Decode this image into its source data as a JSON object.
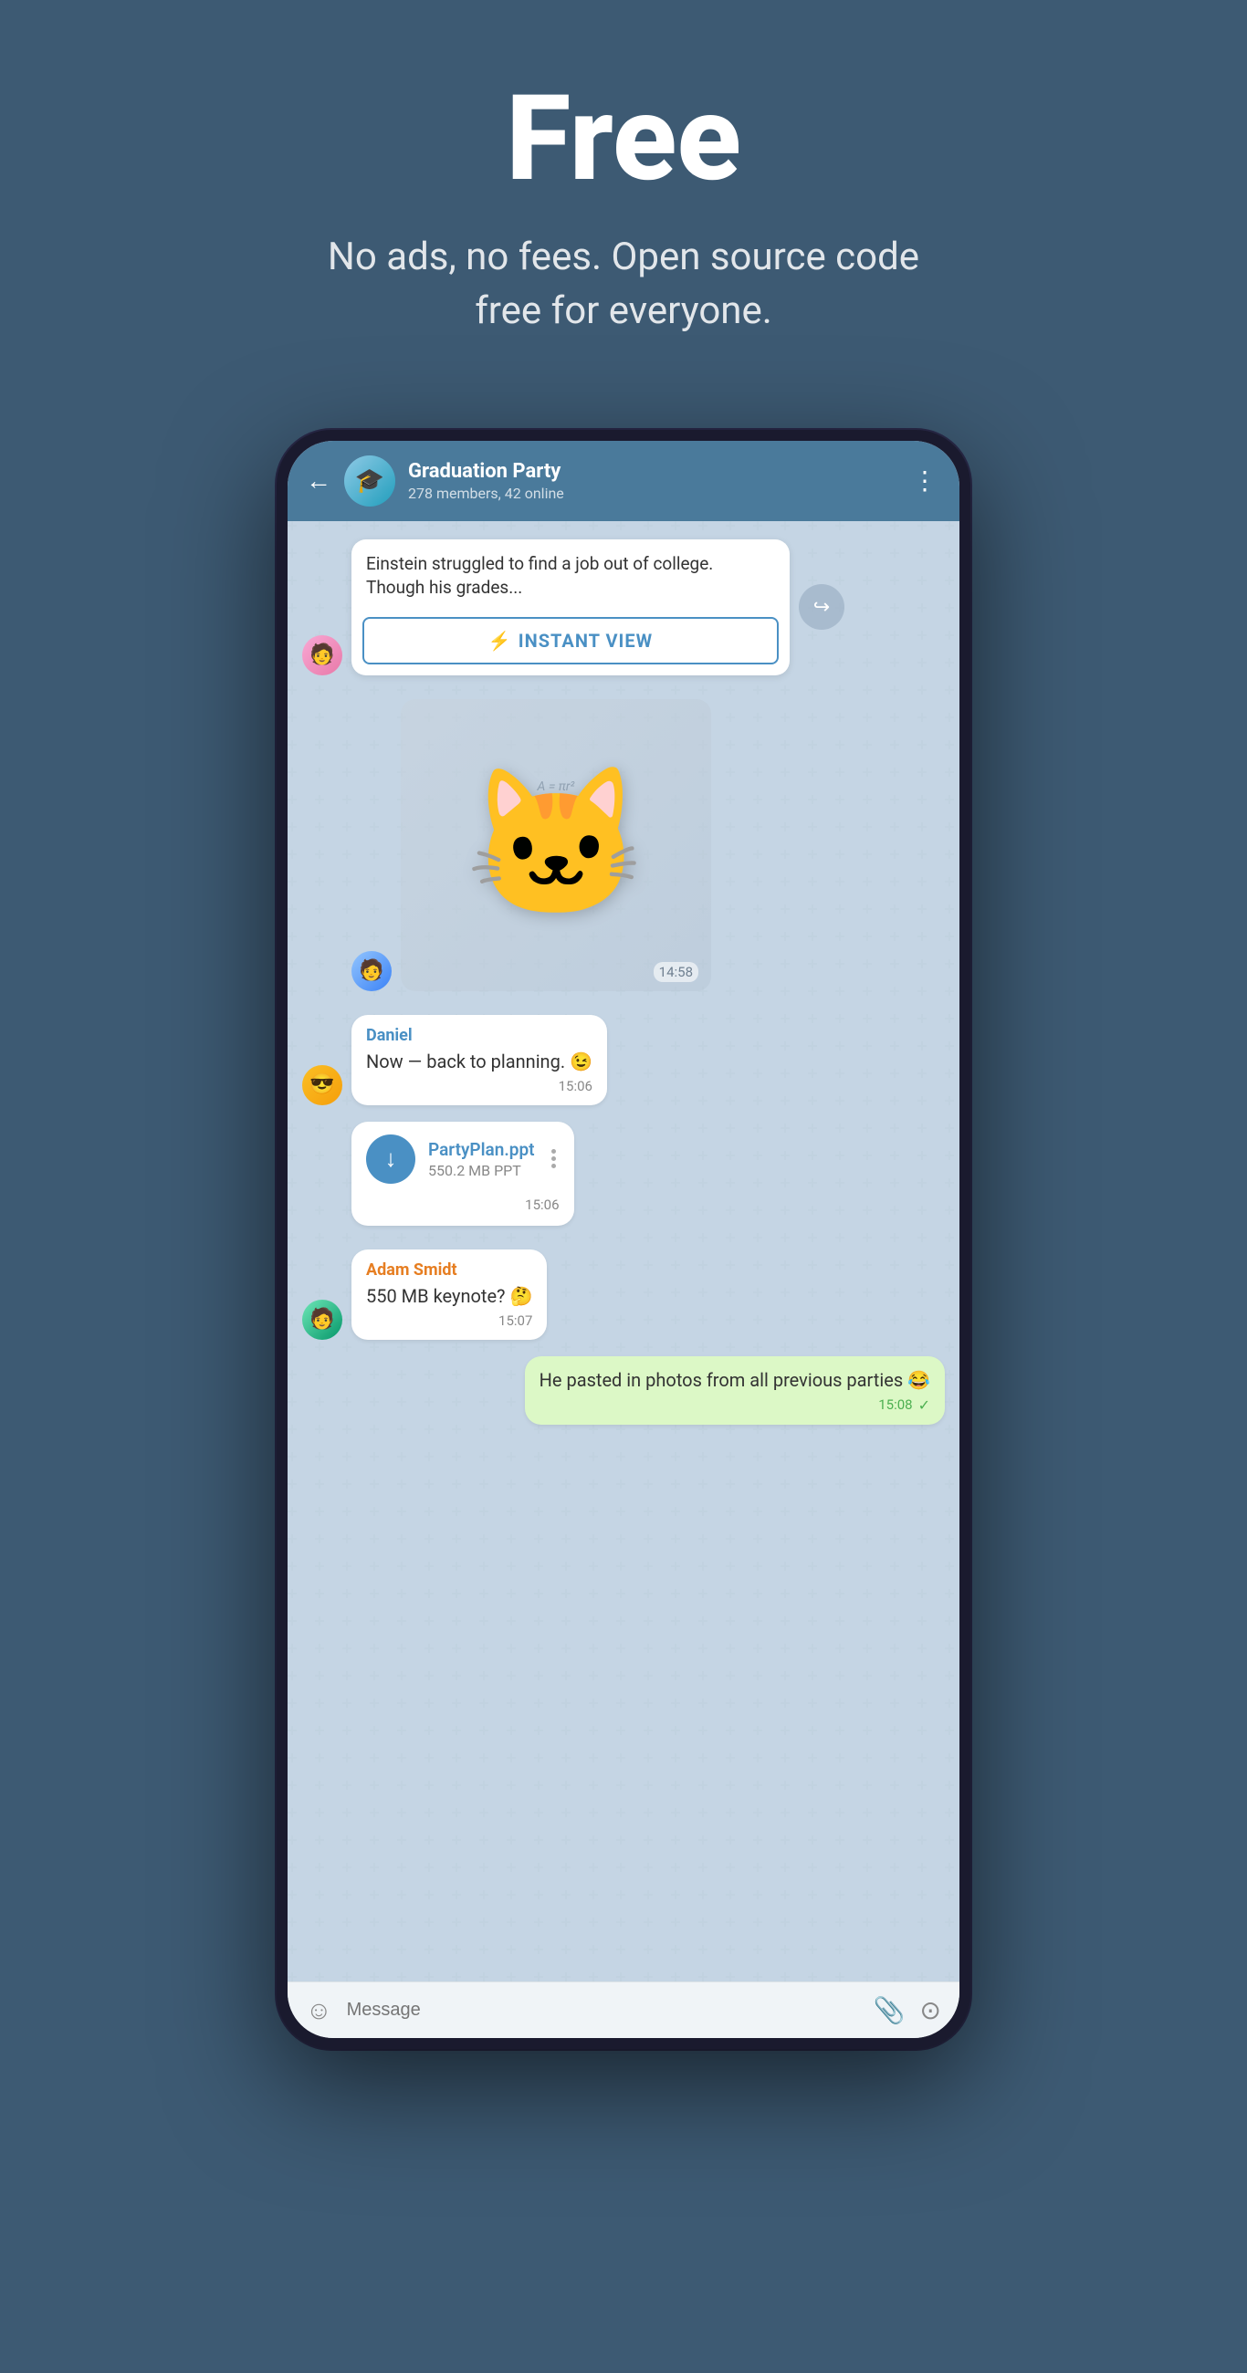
{
  "hero": {
    "title": "Free",
    "subtitle": "No ads, no fees. Open source code free for everyone."
  },
  "chat": {
    "header": {
      "back_label": "←",
      "group_name": "Graduation Party",
      "group_meta": "278 members, 42 online",
      "menu_label": "⋮"
    },
    "article": {
      "preview_text": "Einstein struggled to find a job out of college. Though his grades...",
      "instant_view_label": "INSTANT VIEW",
      "bolt": "⚡"
    },
    "sticker": {
      "time": "14:58",
      "emoji": "🐱"
    },
    "messages": [
      {
        "id": "daniel-msg",
        "sender": "Daniel",
        "text": "Now — back to planning. 😉",
        "time": "15:06",
        "type": "text",
        "side": "left"
      },
      {
        "id": "file-msg",
        "file_name": "PartyPlan.ppt",
        "file_size": "550.2 MB PPT",
        "time": "15:06",
        "type": "file",
        "side": "left"
      },
      {
        "id": "adam-msg",
        "sender": "Adam Smidt",
        "text": "550 MB keynote? 🤔",
        "time": "15:07",
        "type": "text",
        "side": "left"
      },
      {
        "id": "own-msg",
        "text": "He pasted in photos from all previous parties 😂",
        "time": "15:08",
        "type": "text",
        "side": "right"
      }
    ],
    "input_bar": {
      "placeholder": "Message",
      "emoji_icon": "☺",
      "attach_icon": "📎",
      "camera_icon": "⊙"
    }
  }
}
